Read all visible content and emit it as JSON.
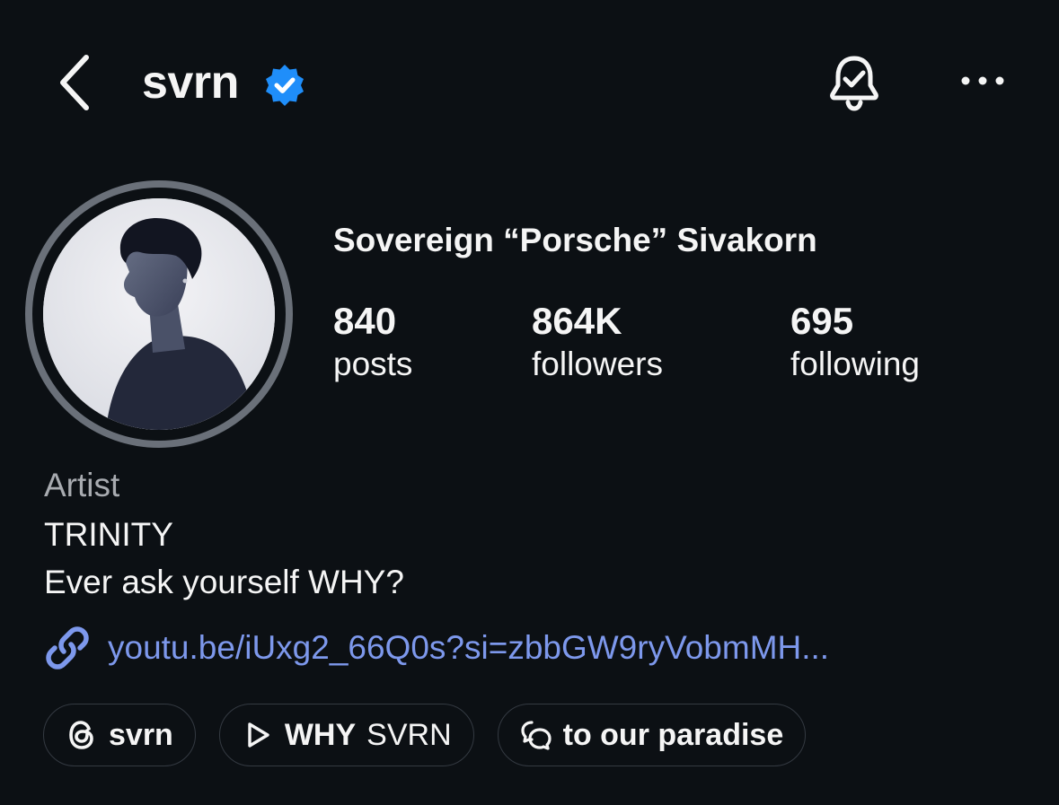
{
  "header": {
    "username": "svrn",
    "back_icon": "chevron-left-icon",
    "verified_icon": "verified-badge-icon",
    "notification_icon": "bell-check-icon",
    "more_icon": "more-horizontal-icon"
  },
  "profile": {
    "display_name": "Sovereign “Porsche” Sivakorn",
    "avatar": "profile-photo",
    "stats": [
      {
        "value": "840",
        "label": "posts"
      },
      {
        "value": "864K",
        "label": "followers"
      },
      {
        "value": "695",
        "label": "following"
      }
    ]
  },
  "bio": {
    "category": "Artist",
    "lines": [
      "TRINITY",
      "Ever ask yourself WHY?"
    ],
    "link": "youtu.be/iUxg2_66Q0s?si=zbbGW9ryVobmMH...",
    "link_icon": "link-icon"
  },
  "chips": [
    {
      "label": "svrn",
      "sub": "",
      "icon": "threads-icon"
    },
    {
      "label": "WHY",
      "sub": "SVRN",
      "icon": "play-icon"
    },
    {
      "label": "to our paradise",
      "sub": "",
      "icon": "chat-bubbles-icon"
    }
  ],
  "colors": {
    "background": "#0c1014",
    "text": "#f5f5f5",
    "muted": "#a8abb0",
    "link": "#7d98ec",
    "verified": "#1f8efa",
    "ring": "#6a7079"
  }
}
